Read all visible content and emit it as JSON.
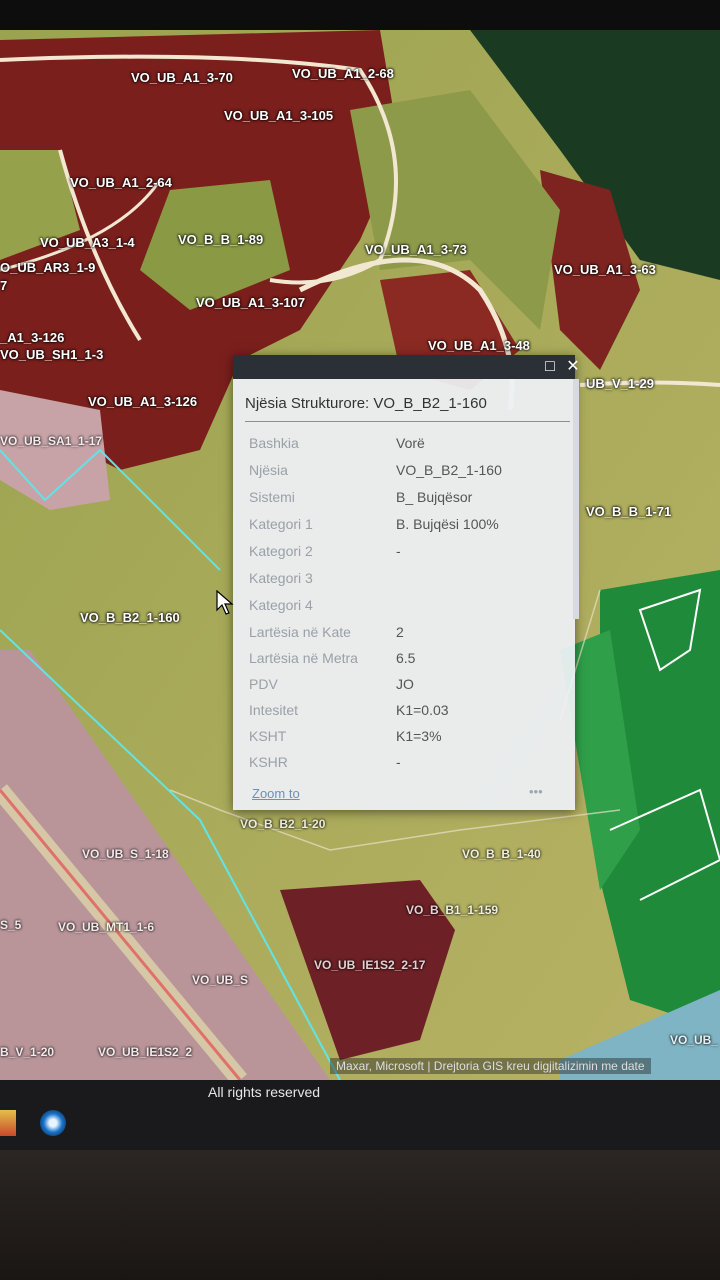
{
  "map": {
    "labels": [
      "VO_UB_A1_3-70",
      "VO_UB_A1_2-68",
      "VO_UB_A1_3-105",
      "VO_UB_A1_2-64",
      "VO_UB_A3_1-4",
      "VO_B_B_1-89",
      "VO_UB_A1_3-73",
      "VO_UB_A1_3-63",
      "O_UB_AR3_1-9",
      "7",
      "VO_UB_A1_3-107",
      "_A1_3-126",
      "VO_UB_SH1_1-3",
      "VO_UB_A1_3-48",
      "VO_UB_A1_3-126",
      "UB_V_1-29",
      "VO_UB_SA1_1-17",
      "VO_B_B_1-71",
      "VO_B_B2_1-160",
      "VO_B_B2_1-20",
      "VO_UB_S_1-18",
      "VO_B_B_1-40",
      "VO_B_B1_1-159",
      "VO_UB_IE1S2_2-17",
      "S_5",
      "VO_UB_MT1_1-6",
      "VO_UB_S",
      "VO_UB_IE1S2_2",
      "B_V_1-20",
      "VO_UB_"
    ],
    "attribution": "Maxar, Microsoft | Drejtoria GIS kreu digjitalizimin me date"
  },
  "popup": {
    "title": "Njësia Strukturore: VO_B_B2_1-160",
    "maximize_icon": "maximize-icon",
    "close_icon": "close-icon",
    "attributes": [
      {
        "key": "Bashkia",
        "value": "Vorë"
      },
      {
        "key": "Njësia",
        "value": "VO_B_B2_1-160"
      },
      {
        "key": "Sistemi",
        "value": "B_ Bujqësor"
      },
      {
        "key": "Kategori 1",
        "value": "B. Bujqësi 100%"
      },
      {
        "key": "Kategori 2",
        "value": "-"
      },
      {
        "key": "Kategori 3",
        "value": ""
      },
      {
        "key": "Kategori 4",
        "value": ""
      },
      {
        "key": "Lartësia në Kate",
        "value": "2"
      },
      {
        "key": "Lartësia në Metra",
        "value": "6.5"
      },
      {
        "key": "PDV",
        "value": "JO"
      },
      {
        "key": "Intesitet",
        "value": "K1=0.03"
      },
      {
        "key": "KSHT",
        "value": "K1=3%"
      },
      {
        "key": "KSHR",
        "value": "-"
      }
    ],
    "zoom_label": "Zoom to",
    "more_label": "•••"
  },
  "footer": {
    "text": "All rights reserved"
  },
  "colors": {
    "urban_parcel": "#7a1f1c",
    "agri_parcel": "#8d9a4a",
    "forest": "#1f8a3a",
    "road": "#f2e8d2",
    "residential": "#b9959a",
    "boundary_cyan": "#5fe4e8"
  }
}
